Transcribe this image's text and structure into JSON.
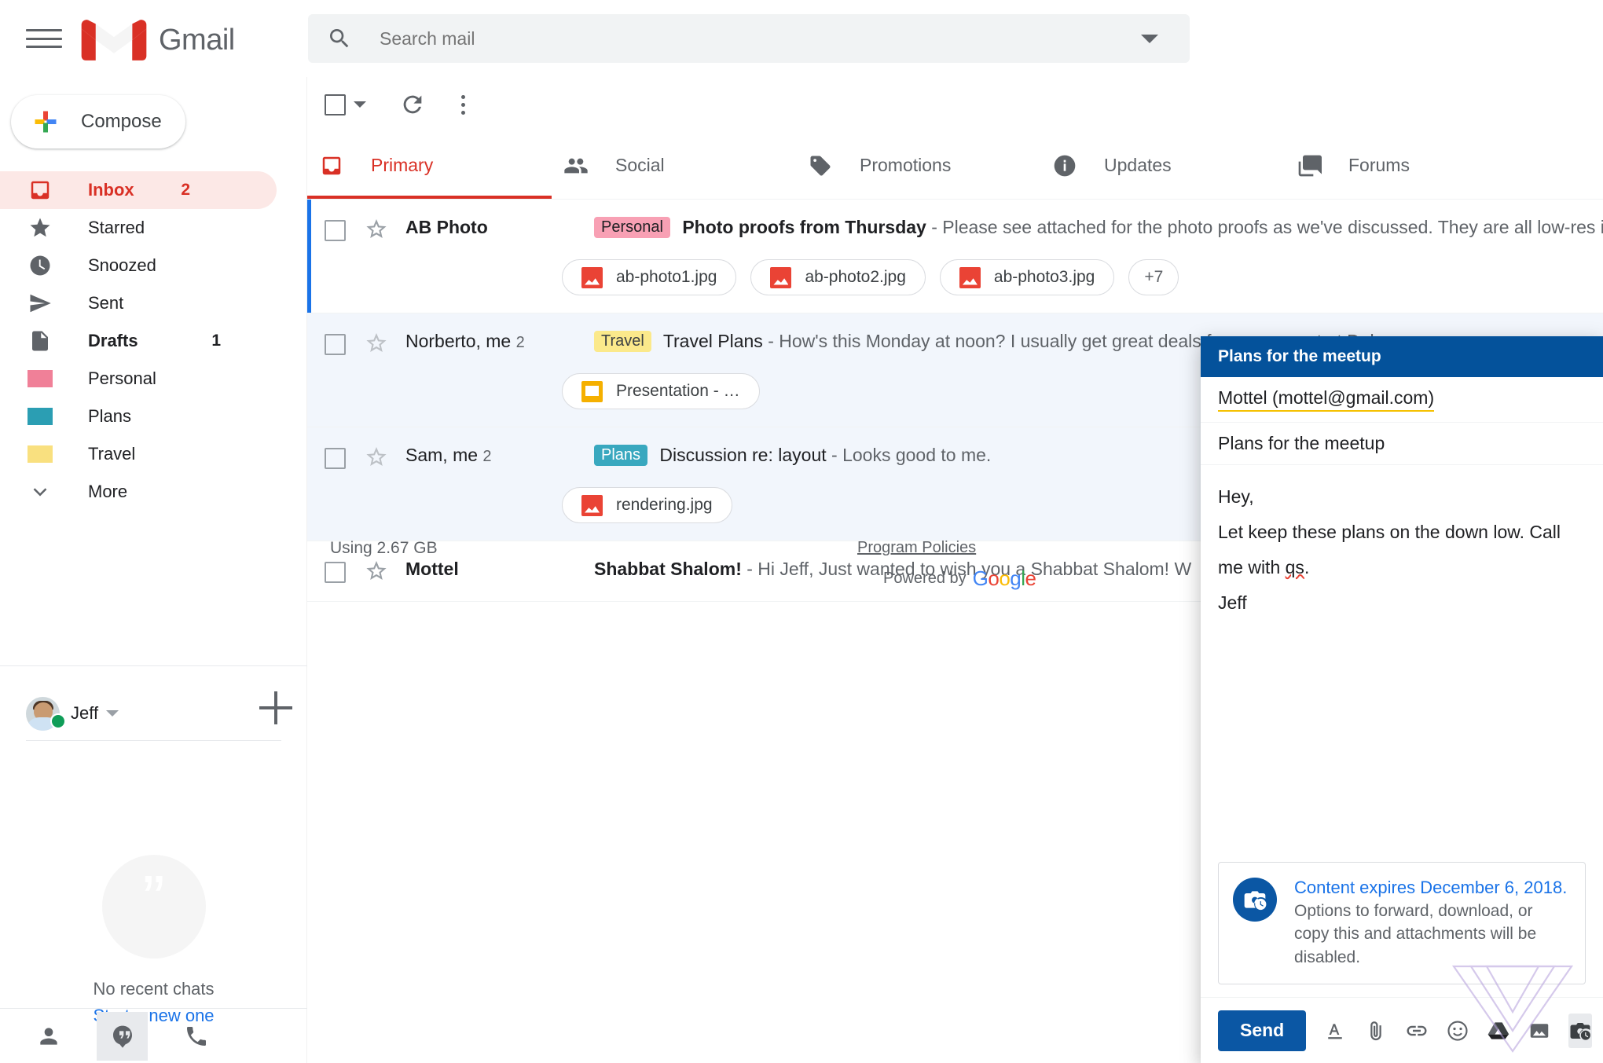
{
  "app": {
    "name": "Gmail",
    "hamburger": "menu-icon"
  },
  "search": {
    "placeholder": "Search mail",
    "value": ""
  },
  "compose_button": {
    "label": "Compose"
  },
  "sidebar": {
    "items": [
      {
        "label": "Inbox",
        "icon": "inbox-icon",
        "count": "2",
        "active": true,
        "bold": true,
        "color": "#d93025"
      },
      {
        "label": "Starred",
        "icon": "star-icon",
        "count": "",
        "active": false,
        "bold": false,
        "color": "#5f6368"
      },
      {
        "label": "Snoozed",
        "icon": "clock-icon",
        "count": "",
        "active": false,
        "bold": false,
        "color": "#5f6368"
      },
      {
        "label": "Sent",
        "icon": "send-icon",
        "count": "",
        "active": false,
        "bold": false,
        "color": "#5f6368"
      },
      {
        "label": "Drafts",
        "icon": "document-icon",
        "count": "1",
        "active": false,
        "bold": true,
        "color": "#5f6368"
      },
      {
        "label": "Personal",
        "icon": "label-tag-icon",
        "count": "",
        "active": false,
        "bold": false,
        "color": "#f08098"
      },
      {
        "label": "Plans",
        "icon": "label-tag-icon",
        "count": "",
        "active": false,
        "bold": false,
        "color": "#2b9eb3"
      },
      {
        "label": "Travel",
        "icon": "label-tag-icon",
        "count": "",
        "active": false,
        "bold": false,
        "color": "#f9e07f"
      },
      {
        "label": "More",
        "icon": "chevron-down-icon",
        "count": "",
        "active": false,
        "bold": false,
        "color": "#5f6368"
      }
    ]
  },
  "hangouts": {
    "user_name": "Jeff",
    "presence_color": "#0f9d58",
    "no_chats_text": "No recent chats",
    "start_link": "Start a new one",
    "tabs": [
      "contacts-icon",
      "chat-icon",
      "phone-icon"
    ]
  },
  "toolbar": {
    "select_all": "select-all-checkbox",
    "refresh": "refresh-icon",
    "more": "more-options-icon"
  },
  "tabs": [
    {
      "label": "Primary",
      "icon": "inbox-icon",
      "active": true
    },
    {
      "label": "Social",
      "icon": "people-icon",
      "active": false
    },
    {
      "label": "Promotions",
      "icon": "tag-icon",
      "active": false
    },
    {
      "label": "Updates",
      "icon": "info-icon",
      "active": false
    },
    {
      "label": "Forums",
      "icon": "forum-icon",
      "active": false
    }
  ],
  "emails": [
    {
      "sender": "AB Photo",
      "count": "",
      "unread": true,
      "selected": true,
      "read_bg": false,
      "badge": "Personal",
      "badge_bg": "#f8a0b4",
      "badge_color": "#202124",
      "subject": "Photo proofs from Thursday",
      "snippet": " - Please see attached for the photo proofs as we've discussed. They are all low-res in",
      "attachments": [
        {
          "name": "ab-photo1.jpg",
          "type": "image"
        },
        {
          "name": "ab-photo2.jpg",
          "type": "image"
        },
        {
          "name": "ab-photo3.jpg",
          "type": "image"
        },
        {
          "name": "+7",
          "type": "more"
        }
      ]
    },
    {
      "sender": "Norberto, me",
      "count": "2",
      "unread": false,
      "selected": false,
      "read_bg": true,
      "badge": "Travel",
      "badge_bg": "#fbe98b",
      "badge_color": "#3c4043",
      "subject": "Travel Plans",
      "snippet": " - How's this Monday at noon? I usually get great deals from my agent at Delux.",
      "attachments": [
        {
          "name": "Presentation - …",
          "type": "slide"
        }
      ]
    },
    {
      "sender": "Sam, me",
      "count": "2",
      "unread": false,
      "selected": false,
      "read_bg": true,
      "badge": "Plans",
      "badge_bg": "#39a8bf",
      "badge_color": "#ffffff",
      "subject": "Discussion re: layout",
      "snippet": " - Looks good to me.",
      "attachments": [
        {
          "name": "rendering.jpg",
          "type": "image"
        }
      ]
    },
    {
      "sender": "Mottel",
      "count": "",
      "unread": true,
      "selected": false,
      "read_bg": false,
      "badge": "",
      "badge_bg": "",
      "badge_color": "",
      "subject": "Shabbat Shalom!",
      "snippet": " - Hi Jeff, Just wanted to wish you a Shabbat Shalom! W",
      "attachments": []
    }
  ],
  "footer": {
    "usage": "Using 2.67 GB",
    "program_policies": "Program Policies",
    "powered_by": "Powered by",
    "google": "Google"
  },
  "compose_window": {
    "title": "Plans for the meetup",
    "to": "Mottel (mottel@gmail.com)",
    "subject": "Plans for the meetup",
    "body_line1": "Hey,",
    "body_line2_a": "Let keep these plans on the down low. Call me with ",
    "body_line2_spell": "qs",
    "body_line2_b": ".",
    "body_line3": "Jeff",
    "notice_title": "Content expires December 6, 2018.",
    "notice_body": "Options to forward, download, or copy this and attachments will be disabled.",
    "send_label": "Send",
    "tools": [
      "format-text-icon",
      "attach-file-icon",
      "insert-link-icon",
      "insert-emoji-icon",
      "google-drive-icon",
      "insert-photo-icon",
      "confidential-mode-icon"
    ],
    "header_color": "#04529b",
    "send_color": "#0b57a4"
  }
}
